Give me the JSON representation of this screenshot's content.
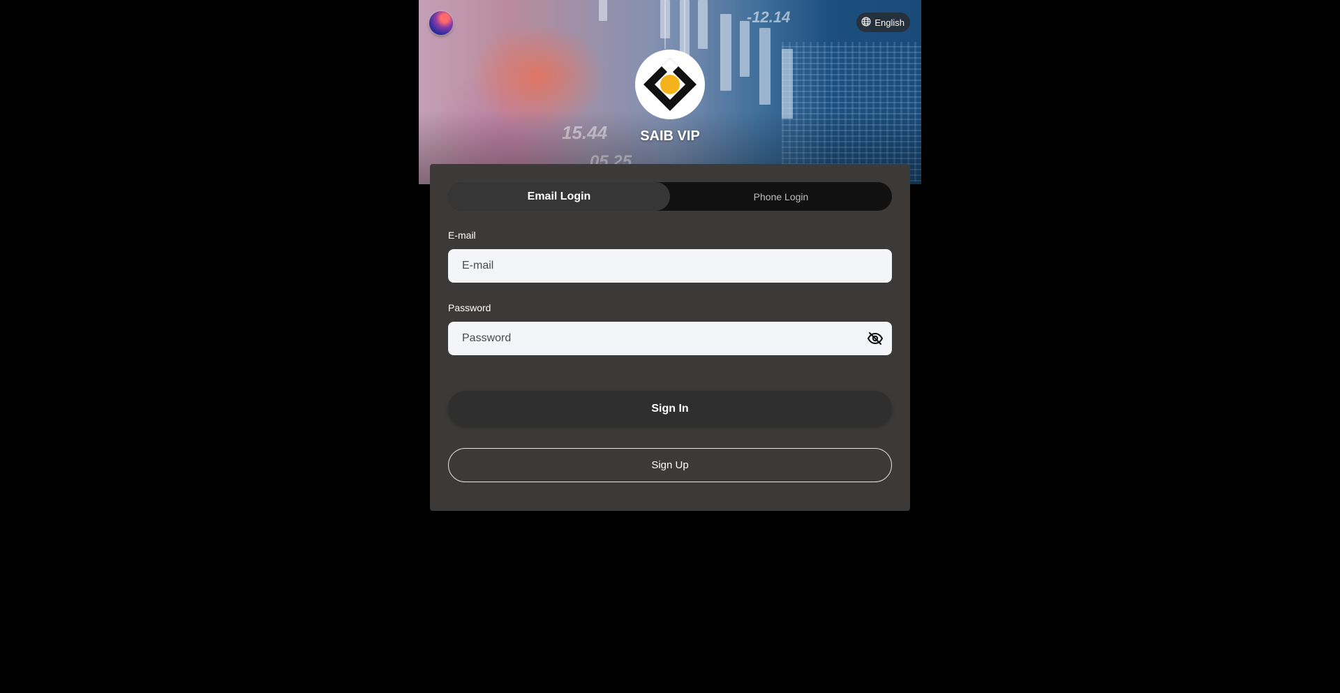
{
  "header": {
    "app_title": "SAIB VIP",
    "language_label": "English",
    "price_tags": [
      "-12.14",
      "15.44",
      "05.25"
    ]
  },
  "tabs": [
    {
      "label": "Email Login",
      "active": true
    },
    {
      "label": "Phone Login",
      "active": false
    }
  ],
  "form": {
    "email": {
      "label": "E-mail",
      "placeholder": "E-mail",
      "value": ""
    },
    "password": {
      "label": "Password",
      "placeholder": "Password",
      "value": ""
    }
  },
  "actions": {
    "sign_in_label": "Sign In",
    "sign_up_label": "Sign Up"
  },
  "icons": {
    "language": "globe-icon",
    "password_toggle": "eye-off-icon",
    "logo": "diamond-logo-icon",
    "avatar": "orb-icon"
  },
  "colors": {
    "page_background": "#000000",
    "card_background": "#3b3a39",
    "input_background": "#f4f5f9",
    "logo_accent": "#f5b21b",
    "button_dark": "#2f2f2f"
  }
}
